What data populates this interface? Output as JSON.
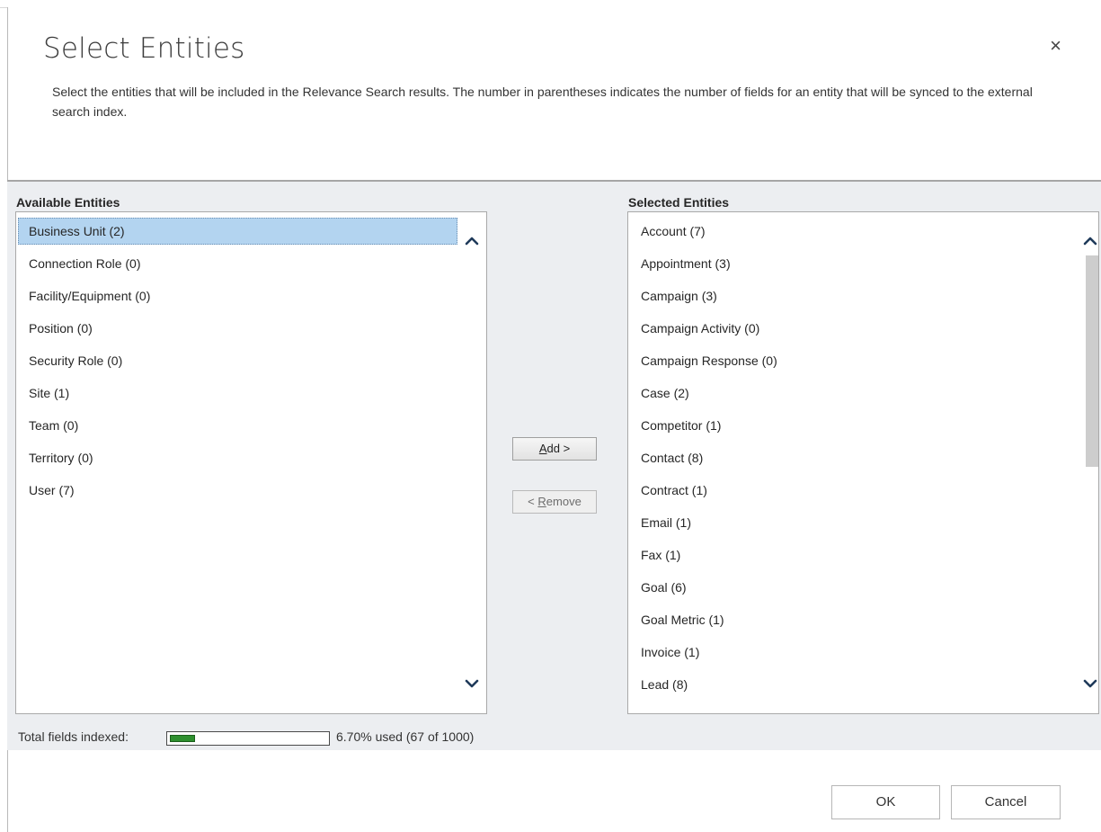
{
  "dialog": {
    "title": "Select Entities",
    "description": "Select the entities that will be included in the Relevance Search results. The number in parentheses indicates the number of fields for an entity that will be synced to the external search index.",
    "close_glyph": "×"
  },
  "available": {
    "label": "Available Entities",
    "items": [
      {
        "label": "Business Unit (2)",
        "selected": true
      },
      {
        "label": "Connection Role (0)"
      },
      {
        "label": "Facility/Equipment (0)"
      },
      {
        "label": "Position (0)"
      },
      {
        "label": "Security Role (0)"
      },
      {
        "label": "Site (1)"
      },
      {
        "label": "Team (0)"
      },
      {
        "label": "Territory (0)"
      },
      {
        "label": "User (7)"
      }
    ]
  },
  "selected": {
    "label": "Selected Entities",
    "items": [
      {
        "label": "Account (7)"
      },
      {
        "label": "Appointment (3)"
      },
      {
        "label": "Campaign (3)"
      },
      {
        "label": "Campaign Activity (0)"
      },
      {
        "label": "Campaign Response (0)"
      },
      {
        "label": "Case (2)"
      },
      {
        "label": "Competitor (1)"
      },
      {
        "label": "Contact (8)"
      },
      {
        "label": "Contract (1)"
      },
      {
        "label": "Email (1)"
      },
      {
        "label": "Fax (1)"
      },
      {
        "label": "Goal (6)"
      },
      {
        "label": "Goal Metric (1)"
      },
      {
        "label": "Invoice (1)"
      },
      {
        "label": "Lead (8)"
      }
    ]
  },
  "actions": {
    "add_prefix": "",
    "add_accel": "A",
    "add_rest": "dd >",
    "remove_prefix": "< ",
    "remove_accel": "R",
    "remove_rest": "emove"
  },
  "index": {
    "label": "Total fields indexed:",
    "used_fraction": 0.067,
    "usage_text": "6.70% used (67 of 1000)"
  },
  "footer": {
    "ok_label": "OK",
    "cancel_label": "Cancel"
  },
  "colors": {
    "selection": "#b3d4f0",
    "progress": "#2e8f2e",
    "panel_bg": "#eceef1"
  }
}
